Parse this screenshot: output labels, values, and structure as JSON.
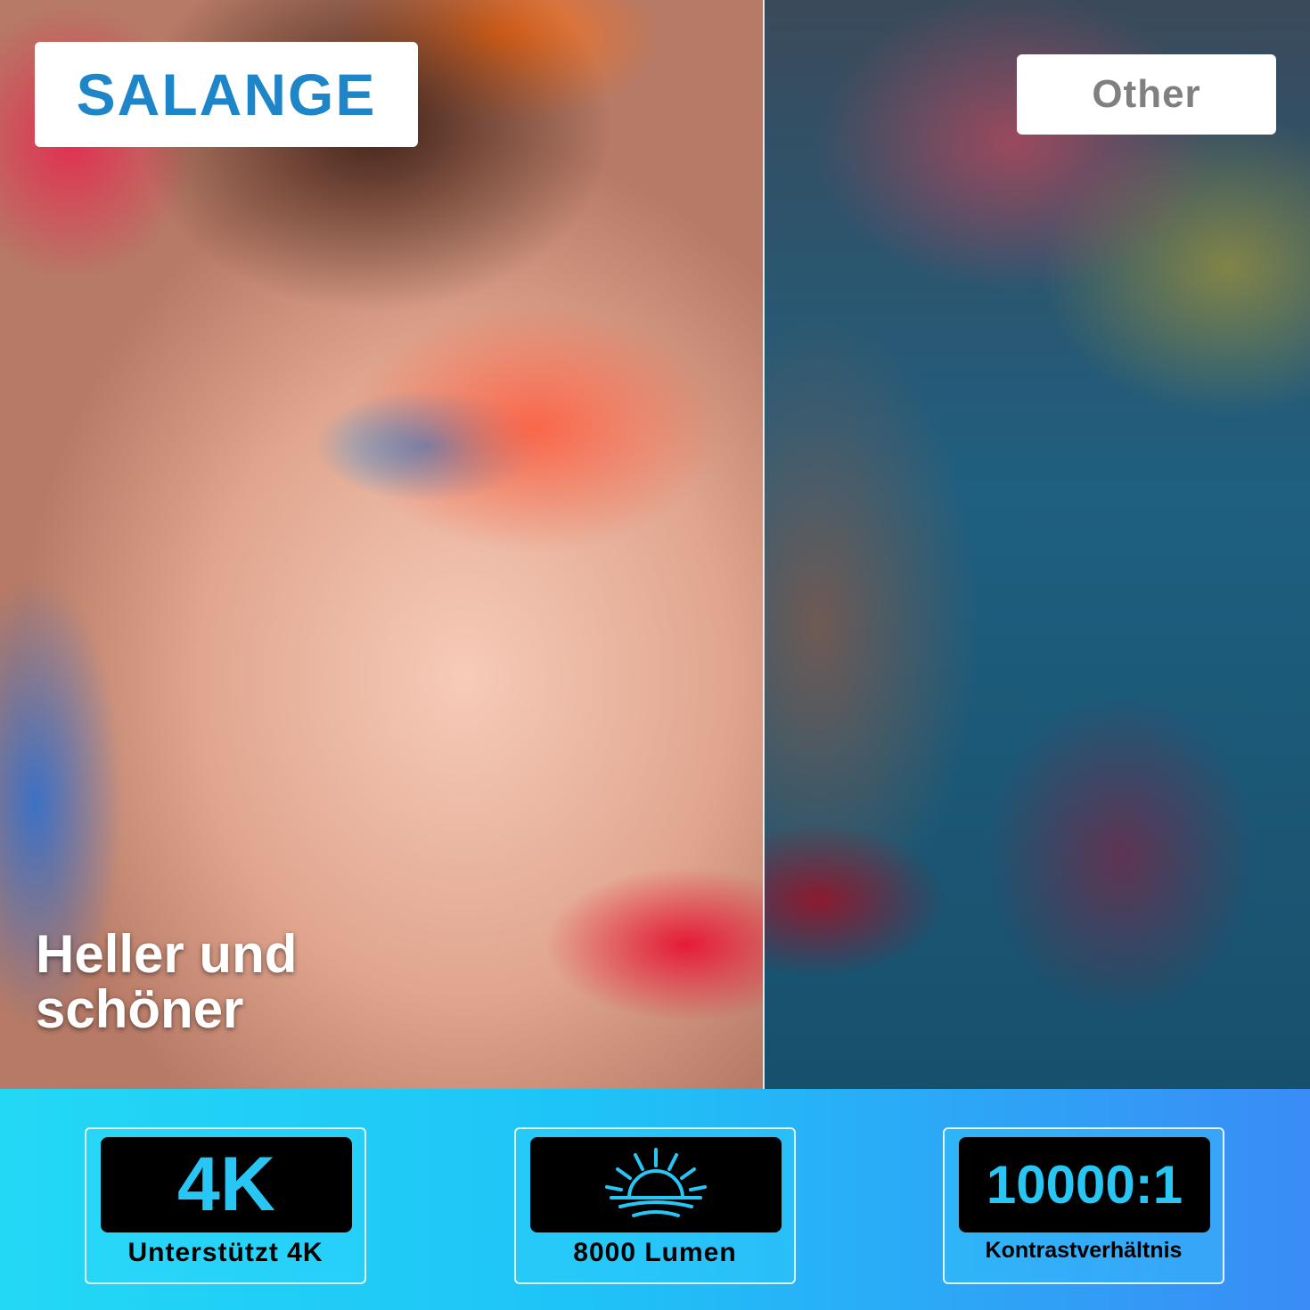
{
  "brand": {
    "logo_text": "SALANGE",
    "color": "#1e86c8"
  },
  "comparison": {
    "other_label": "Other"
  },
  "headline": {
    "line1": "Heller und",
    "line2": "schöner"
  },
  "features": [
    {
      "value": "4K",
      "label": "Unterstützt 4K"
    },
    {
      "icon": "sunrise-icon",
      "label": "8000 Lumen"
    },
    {
      "value": "10000:1",
      "label": "Kontrastverhältnis"
    }
  ],
  "colors": {
    "accent": "#27c6f5",
    "band_start": "#23d8f5",
    "band_end": "#3a8cf6"
  }
}
